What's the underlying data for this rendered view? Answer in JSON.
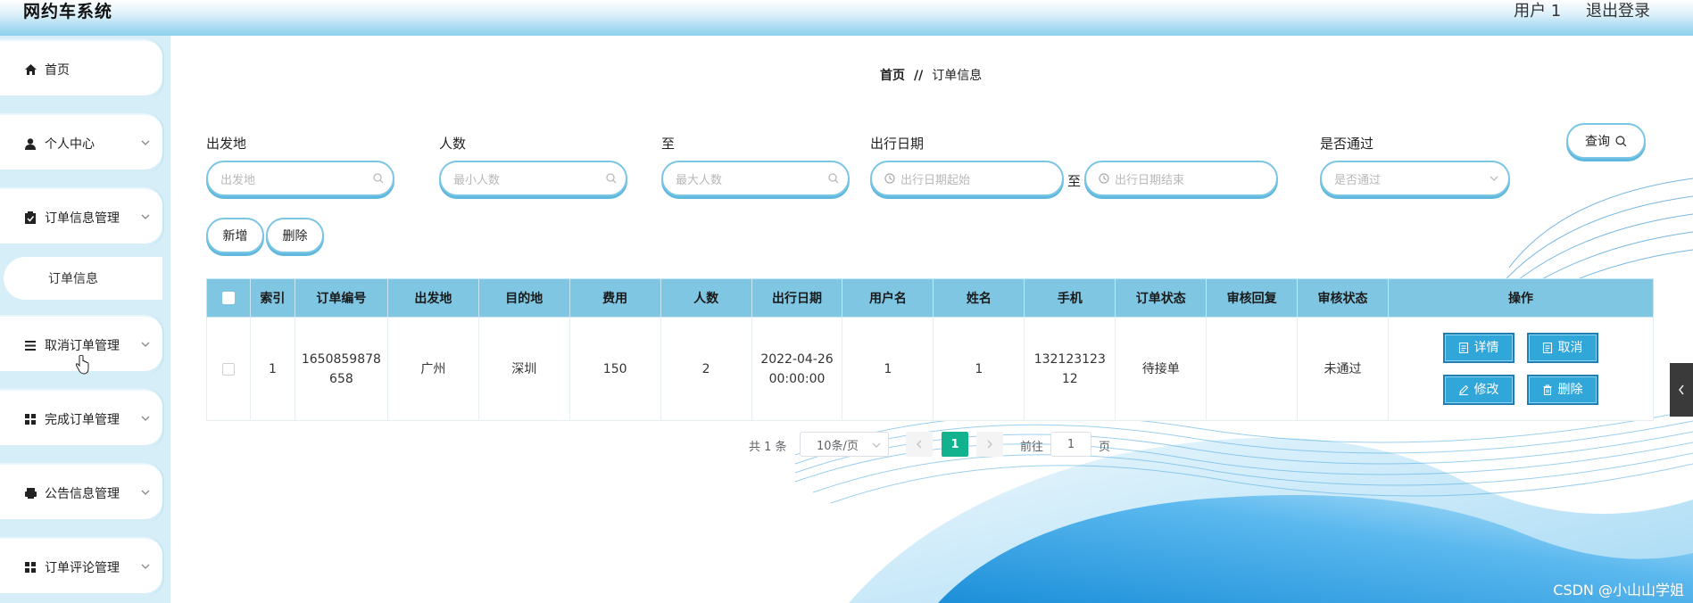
{
  "header": {
    "app_title": "网约车系统",
    "user": "用户 1",
    "logout": "退出登录"
  },
  "sidebar": {
    "items": [
      {
        "label": "首页",
        "icon": "home-icon"
      },
      {
        "label": "个人中心",
        "icon": "user-icon"
      },
      {
        "label": "订单信息管理",
        "icon": "clipboard-icon"
      },
      {
        "label": "取消订单管理",
        "icon": "list-icon"
      },
      {
        "label": "完成订单管理",
        "icon": "grid-icon"
      },
      {
        "label": "公告信息管理",
        "icon": "printer-icon"
      },
      {
        "label": "订单评论管理",
        "icon": "grid-icon"
      }
    ],
    "sub_item": "订单信息"
  },
  "breadcrumb": {
    "home": "首页",
    "sep": "//",
    "current": "订单信息"
  },
  "filters": {
    "origin_label": "出发地",
    "origin_placeholder": "出发地",
    "people_label": "人数",
    "people_min_placeholder": "最小人数",
    "to_label": "至",
    "people_max_placeholder": "最大人数",
    "date_label": "出行日期",
    "date_start_placeholder": "出行日期起始",
    "date_to": "至",
    "date_end_placeholder": "出行日期结束",
    "approved_label": "是否通过",
    "approved_placeholder": "是否通过",
    "query_button": "查询"
  },
  "actions": {
    "add": "新增",
    "delete": "删除"
  },
  "table": {
    "headers": [
      "索引",
      "订单编号",
      "出发地",
      "目的地",
      "费用",
      "人数",
      "出行日期",
      "用户名",
      "姓名",
      "手机",
      "订单状态",
      "审核回复",
      "审核状态",
      "操作"
    ],
    "rows": [
      {
        "index": "1",
        "order_no_1": "1650859878",
        "order_no_2": "658",
        "origin": "广州",
        "destination": "深圳",
        "fee": "150",
        "people": "2",
        "date_1": "2022-04-26",
        "date_2": "00:00:00",
        "username": "1",
        "name": "1",
        "phone_1": "132123123",
        "phone_2": "12",
        "order_status": "待接单",
        "review_reply": "",
        "review_status": "未通过"
      }
    ],
    "op_labels": {
      "detail": "详情",
      "cancel": "取消",
      "edit": "修改",
      "delete": "删除"
    }
  },
  "pagination": {
    "total": "共 1 条",
    "page_size": "10条/页",
    "current": "1",
    "goto_label": "前往",
    "goto_value": "1",
    "page_unit": "页"
  },
  "watermark": "CSDN @小山山学姐",
  "colors": {
    "accent": "#7fc6e3",
    "button": "#31a6d9",
    "page_active": "#13b28f",
    "sidebar_bg": "#d5eef8"
  }
}
